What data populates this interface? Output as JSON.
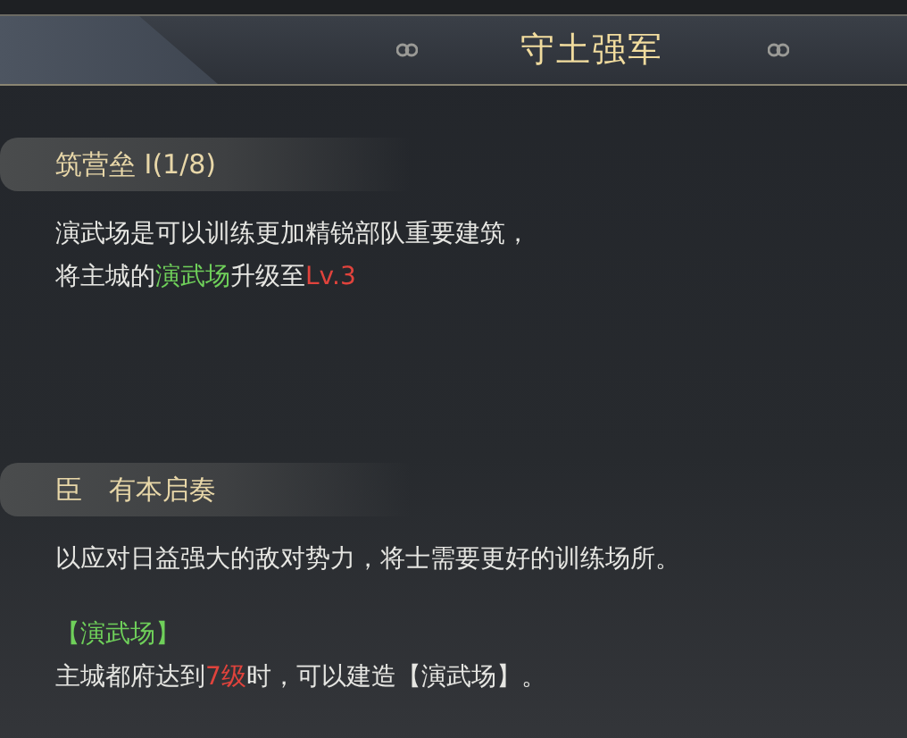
{
  "header": {
    "title": "守土强军"
  },
  "sections": [
    {
      "heading": "筑营垒 Ⅰ(1/8)",
      "paragraphs": [
        {
          "lines": [
            {
              "segments": [
                {
                  "text": "演武场是可以训练更加精锐部队重要建筑，",
                  "kind": "plain"
                }
              ]
            },
            {
              "segments": [
                {
                  "text": "将主城的",
                  "kind": "plain"
                },
                {
                  "text": "演武场",
                  "kind": "highlight"
                },
                {
                  "text": "升级至",
                  "kind": "plain"
                },
                {
                  "text": "Lv.3",
                  "kind": "warning"
                }
              ]
            }
          ]
        }
      ]
    },
    {
      "heading": "臣　有本启奏",
      "paragraphs": [
        {
          "lines": [
            {
              "segments": [
                {
                  "text": "以应对日益强大的敌对势力，将士需要更好的训练场所。",
                  "kind": "plain"
                }
              ]
            }
          ]
        },
        {
          "lines": [
            {
              "segments": [
                {
                  "text": "【演武场】",
                  "kind": "highlight"
                }
              ]
            },
            {
              "segments": [
                {
                  "text": "主城都府达到",
                  "kind": "plain"
                },
                {
                  "text": "7级",
                  "kind": "warning"
                },
                {
                  "text": "时，可以建造【演武场】。",
                  "kind": "plain"
                }
              ]
            }
          ]
        }
      ]
    }
  ]
}
